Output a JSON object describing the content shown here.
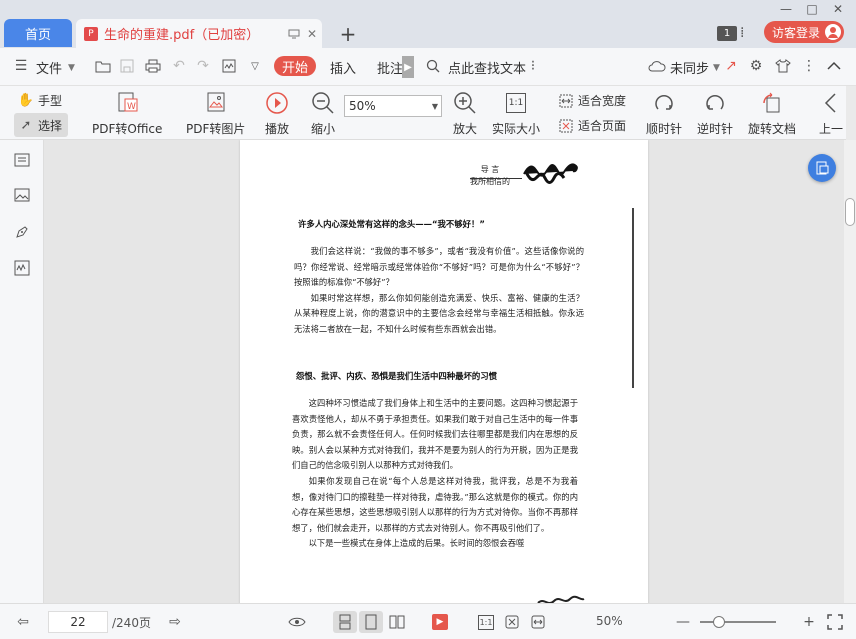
{
  "tabs": {
    "home_label": "首页",
    "doc_title": "生命的重建.pdf（已加密）",
    "doc_badge": "P",
    "add_label": "+"
  },
  "window": {
    "badge_count": "1",
    "menu_glyph": "⁞",
    "login_label": "访客登录",
    "minimize": "—",
    "restore": "□",
    "close": "✕"
  },
  "menubar": {
    "file_label": "文件",
    "start_label": "开始",
    "insert_label": "插入",
    "annotate_label": "批注",
    "search_label": "点此查找文本",
    "sync_label": "未同步"
  },
  "toolbar": {
    "hand_label": "手型",
    "select_label": "选择",
    "pdf_office_label": "PDF转Office",
    "pdf_image_label": "PDF转图片",
    "play_label": "播放",
    "zoom_out_label": "缩小",
    "zoom_value": "50%",
    "zoom_in_label": "放大",
    "actual_size_label": "实际大小",
    "actual_size_icon": "1:1",
    "fit_width_label": "适合宽度",
    "fit_page_label": "适合页面",
    "rotate_cw_label": "顺时针",
    "rotate_ccw_label": "逆时针",
    "rotate_doc_label": "旋转文档",
    "prev_label": "上一"
  },
  "page": {
    "header_title": "导 言",
    "header_subtitle": "我所相信的",
    "heading1": "许多人内心深处常有这样的念头——“我不够好！”",
    "para1": "我们会这样说：“我做的事不够多”，或者“我没有价值”。这些话像你说的吗？你经常说、经常暗示或经常体验你“不够好”吗？可是你为什么“不够好”？按照谁的标准你“不够好”？",
    "para2": "如果时常这样想，那么你如何能创造充满爱、快乐、富裕、健康的生活？从某种程度上说，你的潜意识中的主要信念会经常与幸福生活相抵触。你永远无法将二者放在一起，不知什么时候有些东西就会出错。",
    "heading2": "怨恨、批评、内疚、恐惧是我们生活中四种最坏的习惯",
    "para3": "这四种坏习惯造成了我们身体上和生活中的主要问题。这四种习惯起源于喜欢责怪他人，却从不勇于承担责任。如果我们敢于对自己生活中的每一件事负责，那么就不会责怪任何人。任何时候我们去往哪里都是我们内在思想的反映。别人会以某种方式对待我们，我并不是要为别人的行为开脱，因为正是我们自己的信念吸引别人以那种方式对待我们。",
    "para4": "如果你发现自己在说“每个人总是这样对待我，批评我，总是不为我着想，像对待门口的擦鞋垫一样对待我，虐待我。”那么这就是你的模式。你的内心存在某些思想，这些思想吸引别人以那样的行为方式对待你。当你不再那样想了，他们就会走开，以那样的方式去对待别人。你不再吸引他们了。",
    "para5": "以下是一些模式在身体上造成的后果。长时间的怨恨会吞噬"
  },
  "statusbar": {
    "current_page": "22",
    "total_pages": "/240页",
    "zoom_pct": "50%",
    "zoom_level": 0.25
  },
  "colors": {
    "accent_blue": "#4a86e8",
    "brand_red": "#e5574c"
  }
}
